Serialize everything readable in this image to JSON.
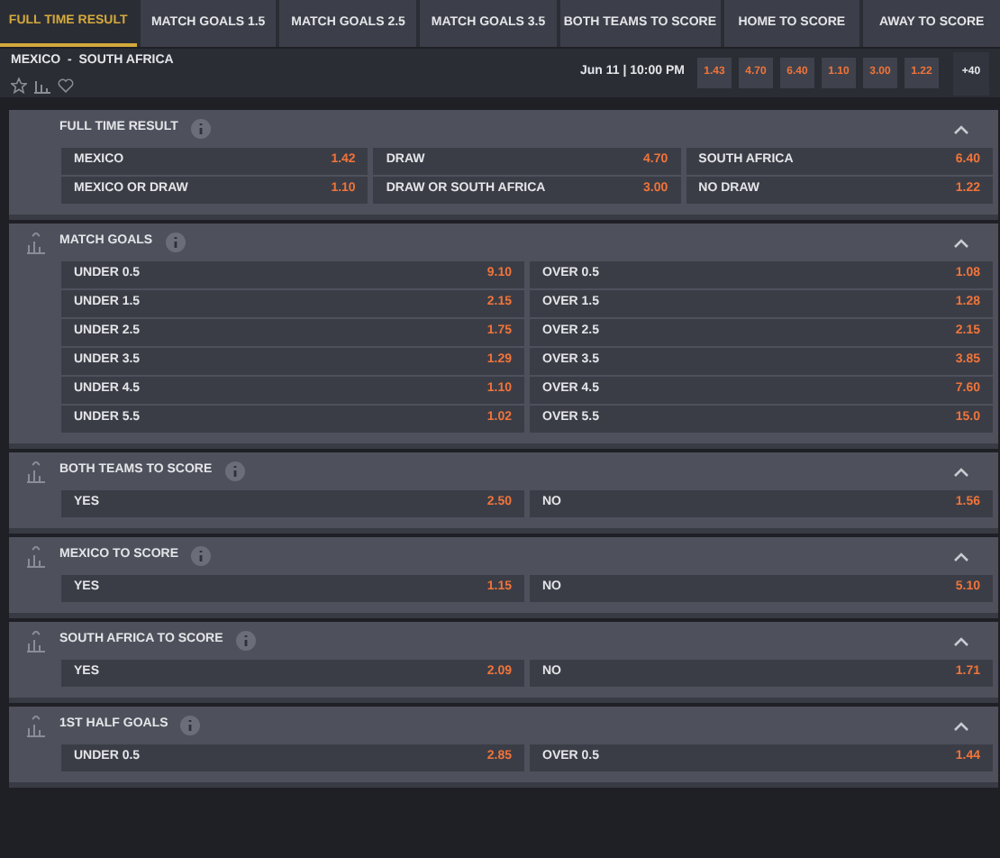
{
  "tabs": [
    {
      "label": "FULL TIME RESULT",
      "selected": true
    },
    {
      "label": "MATCH GOALS 1.5",
      "selected": false
    },
    {
      "label": "MATCH GOALS 2.5",
      "selected": false
    },
    {
      "label": "MATCH GOALS 3.5",
      "selected": false
    },
    {
      "label": "BOTH TEAMS TO SCORE",
      "selected": false
    },
    {
      "label": "HOME TO SCORE",
      "selected": false
    },
    {
      "label": "AWAY TO SCORE",
      "selected": false
    }
  ],
  "match": {
    "teams": "MEXICO  -  SOUTH AFRICA",
    "datetime": "Jun 11 | 10:00 PM",
    "odds": [
      "1.43",
      "4.70",
      "6.40",
      "1.10",
      "3.00",
      "1.22"
    ],
    "more": "+40"
  },
  "sections": [
    {
      "title": "FULL TIME RESULT",
      "kind": "three-way",
      "expanded": true,
      "rows": [
        [
          {
            "label": "MEXICO",
            "odds": "1.42"
          },
          {
            "label": "DRAW",
            "odds": "4.70"
          },
          {
            "label": "SOUTH AFRICA",
            "odds": "6.40"
          }
        ],
        [
          {
            "label": "MEXICO OR DRAW",
            "odds": "1.10"
          },
          {
            "label": "DRAW OR SOUTH AFRICA",
            "odds": "3.00"
          },
          {
            "label": "NO DRAW",
            "odds": "1.22"
          }
        ]
      ]
    },
    {
      "title": "MATCH GOALS",
      "kind": "two-way",
      "expanded": true,
      "rows": [
        [
          {
            "label": "UNDER 0.5",
            "odds": "9.10"
          },
          {
            "label": "OVER 0.5",
            "odds": "1.08"
          }
        ],
        [
          {
            "label": "UNDER 1.5",
            "odds": "2.15"
          },
          {
            "label": "OVER 1.5",
            "odds": "1.28"
          }
        ],
        [
          {
            "label": "UNDER 2.5",
            "odds": "1.75"
          },
          {
            "label": "OVER 2.5",
            "odds": "2.15"
          }
        ],
        [
          {
            "label": "UNDER 3.5",
            "odds": "1.29"
          },
          {
            "label": "OVER 3.5",
            "odds": "3.85"
          }
        ],
        [
          {
            "label": "UNDER 4.5",
            "odds": "1.10"
          },
          {
            "label": "OVER 4.5",
            "odds": "7.60"
          }
        ],
        [
          {
            "label": "UNDER 5.5",
            "odds": "1.02"
          },
          {
            "label": "OVER 5.5",
            "odds": "15.0"
          }
        ]
      ]
    },
    {
      "title": "BOTH TEAMS TO SCORE",
      "kind": "two-way",
      "expanded": true,
      "rows": [
        [
          {
            "label": "YES",
            "odds": "2.50"
          },
          {
            "label": "NO",
            "odds": "1.56"
          }
        ]
      ]
    },
    {
      "title": "MEXICO TO SCORE",
      "kind": "two-way",
      "expanded": true,
      "rows": [
        [
          {
            "label": "YES",
            "odds": "1.15"
          },
          {
            "label": "NO",
            "odds": "5.10"
          }
        ]
      ]
    },
    {
      "title": "SOUTH AFRICA TO SCORE",
      "kind": "two-way",
      "expanded": true,
      "rows": [
        [
          {
            "label": "YES",
            "odds": "2.09"
          },
          {
            "label": "NO",
            "odds": "1.71"
          }
        ]
      ]
    },
    {
      "title": "1ST HALF GOALS",
      "kind": "two-way",
      "expanded": true,
      "rows": [
        [
          {
            "label": "UNDER 0.5",
            "odds": "2.85"
          },
          {
            "label": "OVER 0.5",
            "odds": "1.44"
          }
        ]
      ]
    }
  ]
}
